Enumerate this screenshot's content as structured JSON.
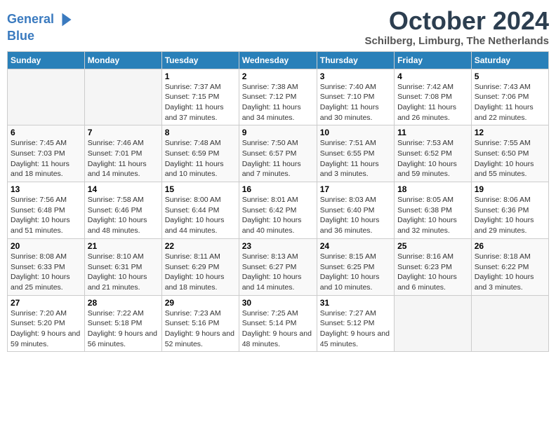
{
  "logo": {
    "line1": "General",
    "line2": "Blue",
    "arrow": "▶"
  },
  "title": "October 2024",
  "location": "Schilberg, Limburg, The Netherlands",
  "days_of_week": [
    "Sunday",
    "Monday",
    "Tuesday",
    "Wednesday",
    "Thursday",
    "Friday",
    "Saturday"
  ],
  "weeks": [
    [
      {
        "day": "",
        "info": ""
      },
      {
        "day": "",
        "info": ""
      },
      {
        "day": "1",
        "info": "Sunrise: 7:37 AM\nSunset: 7:15 PM\nDaylight: 11 hours and 37 minutes."
      },
      {
        "day": "2",
        "info": "Sunrise: 7:38 AM\nSunset: 7:12 PM\nDaylight: 11 hours and 34 minutes."
      },
      {
        "day": "3",
        "info": "Sunrise: 7:40 AM\nSunset: 7:10 PM\nDaylight: 11 hours and 30 minutes."
      },
      {
        "day": "4",
        "info": "Sunrise: 7:42 AM\nSunset: 7:08 PM\nDaylight: 11 hours and 26 minutes."
      },
      {
        "day": "5",
        "info": "Sunrise: 7:43 AM\nSunset: 7:06 PM\nDaylight: 11 hours and 22 minutes."
      }
    ],
    [
      {
        "day": "6",
        "info": "Sunrise: 7:45 AM\nSunset: 7:03 PM\nDaylight: 11 hours and 18 minutes."
      },
      {
        "day": "7",
        "info": "Sunrise: 7:46 AM\nSunset: 7:01 PM\nDaylight: 11 hours and 14 minutes."
      },
      {
        "day": "8",
        "info": "Sunrise: 7:48 AM\nSunset: 6:59 PM\nDaylight: 11 hours and 10 minutes."
      },
      {
        "day": "9",
        "info": "Sunrise: 7:50 AM\nSunset: 6:57 PM\nDaylight: 11 hours and 7 minutes."
      },
      {
        "day": "10",
        "info": "Sunrise: 7:51 AM\nSunset: 6:55 PM\nDaylight: 11 hours and 3 minutes."
      },
      {
        "day": "11",
        "info": "Sunrise: 7:53 AM\nSunset: 6:52 PM\nDaylight: 10 hours and 59 minutes."
      },
      {
        "day": "12",
        "info": "Sunrise: 7:55 AM\nSunset: 6:50 PM\nDaylight: 10 hours and 55 minutes."
      }
    ],
    [
      {
        "day": "13",
        "info": "Sunrise: 7:56 AM\nSunset: 6:48 PM\nDaylight: 10 hours and 51 minutes."
      },
      {
        "day": "14",
        "info": "Sunrise: 7:58 AM\nSunset: 6:46 PM\nDaylight: 10 hours and 48 minutes."
      },
      {
        "day": "15",
        "info": "Sunrise: 8:00 AM\nSunset: 6:44 PM\nDaylight: 10 hours and 44 minutes."
      },
      {
        "day": "16",
        "info": "Sunrise: 8:01 AM\nSunset: 6:42 PM\nDaylight: 10 hours and 40 minutes."
      },
      {
        "day": "17",
        "info": "Sunrise: 8:03 AM\nSunset: 6:40 PM\nDaylight: 10 hours and 36 minutes."
      },
      {
        "day": "18",
        "info": "Sunrise: 8:05 AM\nSunset: 6:38 PM\nDaylight: 10 hours and 32 minutes."
      },
      {
        "day": "19",
        "info": "Sunrise: 8:06 AM\nSunset: 6:36 PM\nDaylight: 10 hours and 29 minutes."
      }
    ],
    [
      {
        "day": "20",
        "info": "Sunrise: 8:08 AM\nSunset: 6:33 PM\nDaylight: 10 hours and 25 minutes."
      },
      {
        "day": "21",
        "info": "Sunrise: 8:10 AM\nSunset: 6:31 PM\nDaylight: 10 hours and 21 minutes."
      },
      {
        "day": "22",
        "info": "Sunrise: 8:11 AM\nSunset: 6:29 PM\nDaylight: 10 hours and 18 minutes."
      },
      {
        "day": "23",
        "info": "Sunrise: 8:13 AM\nSunset: 6:27 PM\nDaylight: 10 hours and 14 minutes."
      },
      {
        "day": "24",
        "info": "Sunrise: 8:15 AM\nSunset: 6:25 PM\nDaylight: 10 hours and 10 minutes."
      },
      {
        "day": "25",
        "info": "Sunrise: 8:16 AM\nSunset: 6:23 PM\nDaylight: 10 hours and 6 minutes."
      },
      {
        "day": "26",
        "info": "Sunrise: 8:18 AM\nSunset: 6:22 PM\nDaylight: 10 hours and 3 minutes."
      }
    ],
    [
      {
        "day": "27",
        "info": "Sunrise: 7:20 AM\nSunset: 5:20 PM\nDaylight: 9 hours and 59 minutes."
      },
      {
        "day": "28",
        "info": "Sunrise: 7:22 AM\nSunset: 5:18 PM\nDaylight: 9 hours and 56 minutes."
      },
      {
        "day": "29",
        "info": "Sunrise: 7:23 AM\nSunset: 5:16 PM\nDaylight: 9 hours and 52 minutes."
      },
      {
        "day": "30",
        "info": "Sunrise: 7:25 AM\nSunset: 5:14 PM\nDaylight: 9 hours and 48 minutes."
      },
      {
        "day": "31",
        "info": "Sunrise: 7:27 AM\nSunset: 5:12 PM\nDaylight: 9 hours and 45 minutes."
      },
      {
        "day": "",
        "info": ""
      },
      {
        "day": "",
        "info": ""
      }
    ]
  ]
}
